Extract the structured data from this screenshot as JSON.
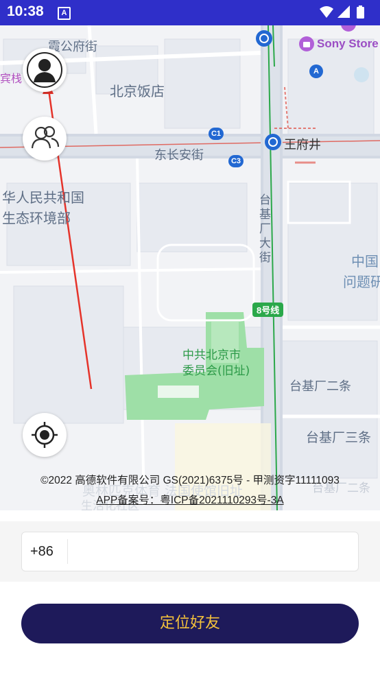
{
  "status_bar": {
    "time": "10:38",
    "notification_icon": "A",
    "icons": [
      "wifi-icon",
      "signal-icon",
      "battery-icon"
    ]
  },
  "map": {
    "labels": {
      "lingong_fujie": "霞公府街",
      "binguan": "宾栈",
      "beijing_hotel": "北京饭店",
      "dongchangan": "东长安街",
      "wangfujing": "王府井",
      "sony_store": "Sony Store",
      "ministry_line1": "华人民共和国",
      "ministry_line2": "生态环境部",
      "taijichang_dajie": "台基厂大街",
      "china_line1": "中国",
      "china_line2": "问题研",
      "committee_line1": "中共北京市",
      "committee_line2": "委员会(旧址)",
      "taijichang_ertiao": "台基厂二条",
      "taijichang_santiao": "台基厂三条",
      "taijichang_ertiao_faint": "台基厂二条",
      "faint_bottom": "奥林匹克体育 法国使馆旧址",
      "faint_bottom2": "生活化社区"
    },
    "metro_badges": {
      "c1": "C1",
      "c3": "C3",
      "a": "A"
    },
    "line8_label": "8号线",
    "copyright": "©2022 高德软件有限公司 GS(2021)6375号 - 甲测资字11111093",
    "icp": "APP备案号：粤ICP备2021110293号-3A",
    "colors": {
      "road": "#d2d8e3",
      "green": "#9edfa7",
      "metro_red": "#e04b40",
      "line8": "#2ba84a",
      "pin_arrow": "#e5332a"
    }
  },
  "phone": {
    "country_code": "+86",
    "value": "",
    "placeholder": ""
  },
  "action": {
    "locate_label": "定位好友"
  }
}
